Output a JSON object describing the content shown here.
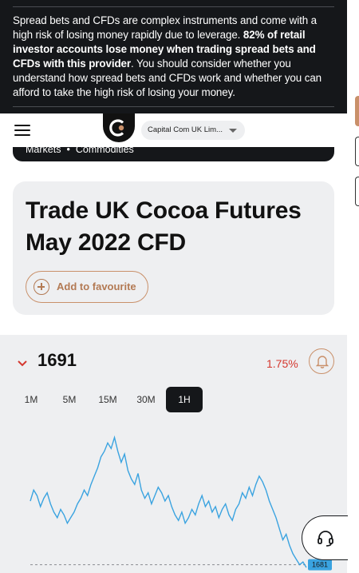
{
  "risk_warning": {
    "lead": "Spread bets and CFDs are complex instruments and come with a high risk of losing money rapidly due to leverage. ",
    "highlight": "82% of retail investor accounts lose money when trading spread bets and CFDs with this provider",
    "tail": ". You should consider whether you understand how spread bets and CFDs work and whether you can afford to take the high risk of losing your money."
  },
  "header": {
    "menu_icon": "hamburger-icon",
    "logo_icon": "capital-com-logo",
    "entity": "Capital Com UK Lim..."
  },
  "breadcrumb": {
    "items": [
      "Markets",
      "Commodities"
    ],
    "separator": "•"
  },
  "instrument": {
    "title": "Trade UK Cocoa Futures May 2022 CFD",
    "favourite_label": "Add to favourite"
  },
  "quote": {
    "price": "1691",
    "change": "1.75%",
    "direction_icon": "chevron-down-icon",
    "alert_icon": "bell-icon"
  },
  "timeframes": [
    "1M",
    "5M",
    "15M",
    "30M",
    "1H"
  ],
  "selected_timeframe": "1H",
  "colors": {
    "accent": "#c9906a",
    "down": "#d4382f",
    "line": "#3aa3e0",
    "dark": "#15171a"
  },
  "support_icon": "headset-icon",
  "chart_data": {
    "type": "line",
    "current_price_label": "1681",
    "values": [
      1704,
      1708,
      1706,
      1702,
      1705,
      1707,
      1703,
      1700,
      1698,
      1701,
      1699,
      1696,
      1698,
      1700,
      1703,
      1705,
      1708,
      1706,
      1710,
      1713,
      1716,
      1720,
      1722,
      1725,
      1723,
      1727,
      1722,
      1718,
      1721,
      1715,
      1712,
      1710,
      1714,
      1708,
      1705,
      1707,
      1703,
      1706,
      1709,
      1707,
      1704,
      1706,
      1702,
      1699,
      1697,
      1700,
      1696,
      1698,
      1701,
      1699,
      1703,
      1706,
      1702,
      1704,
      1700,
      1702,
      1698,
      1701,
      1703,
      1699,
      1697,
      1701,
      1703,
      1707,
      1705,
      1709,
      1706,
      1710,
      1713,
      1711,
      1708,
      1704,
      1701,
      1698,
      1694,
      1690,
      1692,
      1688,
      1685,
      1683,
      1681,
      1682,
      1680
    ],
    "ylim": [
      1678,
      1730
    ]
  }
}
